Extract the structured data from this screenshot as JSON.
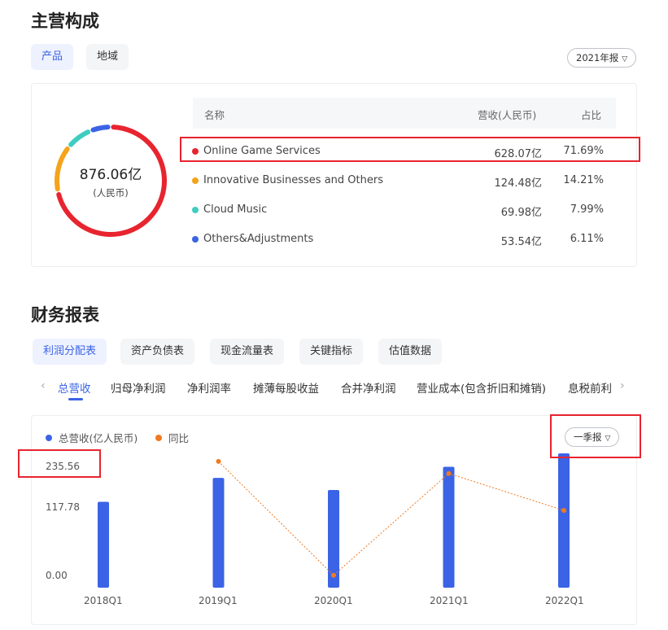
{
  "main_business": {
    "title": "主营构成",
    "tabs": [
      {
        "label": "产品",
        "active": true
      },
      {
        "label": "地域",
        "active": false
      }
    ],
    "period_select": "2021年报",
    "total_value": "876.06亿",
    "total_unit": "(人民币)",
    "table": {
      "headers": [
        "名称",
        "营收(人民币)",
        "占比"
      ],
      "rows": [
        {
          "name": "Online Game Services",
          "revenue": "628.07亿",
          "share": "71.69%",
          "color": "#e8242f",
          "fraction": 0.7169
        },
        {
          "name": "Innovative Businesses and Others",
          "revenue": "124.48亿",
          "share": "14.21%",
          "color": "#f4a31b",
          "fraction": 0.1421
        },
        {
          "name": "Cloud Music",
          "revenue": "69.98亿",
          "share": "7.99%",
          "color": "#3ecdc0",
          "fraction": 0.0799
        },
        {
          "name": "Others&Adjustments",
          "revenue": "53.54亿",
          "share": "6.11%",
          "color": "#3b63e6",
          "fraction": 0.0611
        }
      ]
    }
  },
  "financials": {
    "title": "财务报表",
    "statement_tabs": [
      {
        "label": "利润分配表",
        "active": true
      },
      {
        "label": "资产负债表",
        "active": false
      },
      {
        "label": "现金流量表",
        "active": false
      },
      {
        "label": "关键指标",
        "active": false
      },
      {
        "label": "估值数据",
        "active": false
      }
    ],
    "metric_tabs": [
      {
        "label": "总营收",
        "active": true
      },
      {
        "label": "归母净利润",
        "active": false
      },
      {
        "label": "净利润率",
        "active": false
      },
      {
        "label": "摊薄每股收益",
        "active": false
      },
      {
        "label": "合并净利润",
        "active": false
      },
      {
        "label": "营业成本(包含折旧和摊销)",
        "active": false
      },
      {
        "label": "息税前利",
        "active": false
      }
    ],
    "nav_left": "‹",
    "nav_right": "›",
    "period_select": "一季报"
  },
  "chart_data": {
    "type": "bar",
    "categories": [
      "2018Q1",
      "2019Q1",
      "2020Q1",
      "2021Q1",
      "2022Q1"
    ],
    "series": [
      {
        "name": "总营收(亿人民币)",
        "kind": "bar",
        "color": "#3b63e6",
        "values": [
          150.7,
          192.6,
          171.4,
          212.0,
          235.56
        ]
      },
      {
        "name": "同比",
        "kind": "line",
        "color": "#f07a22",
        "values": [
          null,
          27.8,
          -11.0,
          23.7,
          11.1
        ]
      }
    ],
    "y_ticks": [
      "0.00",
      "117.78",
      "235.56"
    ],
    "ylim": [
      0,
      235.56
    ],
    "y2lim": [
      -13,
      30
    ],
    "legend_position": "top-left",
    "grid": false
  }
}
